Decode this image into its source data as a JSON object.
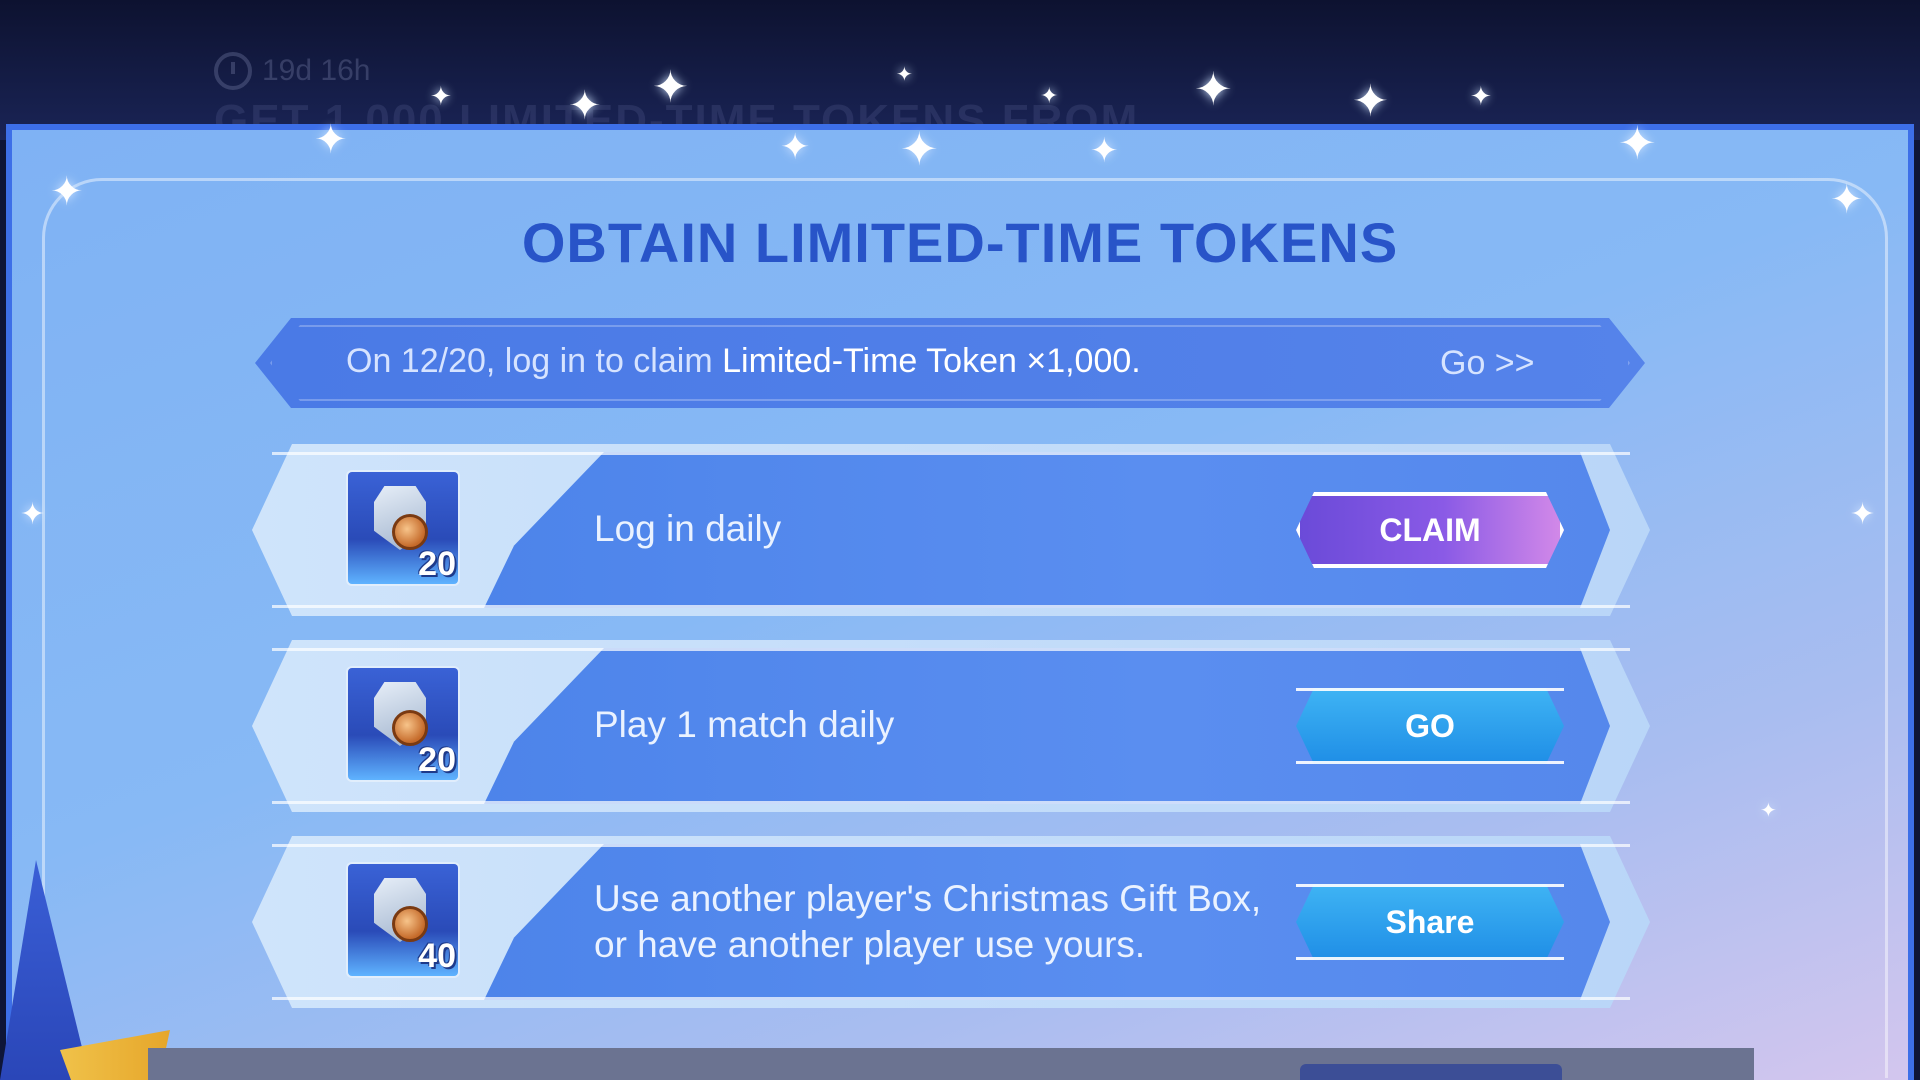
{
  "header": {
    "timer": "19d 16h",
    "ghost_title": "GET 1,000 LIMITED-TIME TOKENS FROM"
  },
  "panel": {
    "title": "OBTAIN LIMITED-TIME TOKENS"
  },
  "banner": {
    "text_prefix": "On 12/20, log in to claim",
    "text_highlight": "Limited-Time Token ×1,000.",
    "go_label": "Go >>"
  },
  "tasks": [
    {
      "reward_qty": "20",
      "label_line1": "Log in daily",
      "label_line2": "",
      "button": "CLAIM",
      "button_style": "claim"
    },
    {
      "reward_qty": "20",
      "label_line1": "Play 1 match daily",
      "label_line2": "",
      "button": "GO",
      "button_style": "blue"
    },
    {
      "reward_qty": "40",
      "label_line1": "Use another player's Christmas Gift Box,",
      "label_line2": "or have another player use yours.",
      "button": "Share",
      "button_style": "blue"
    }
  ],
  "colors": {
    "title": "#2854c8",
    "frame": "#3d6fe8",
    "claim_button": "#8a5ae6",
    "go_button": "#1f8ee6"
  },
  "icons": [
    "clock-icon",
    "token-icon"
  ]
}
